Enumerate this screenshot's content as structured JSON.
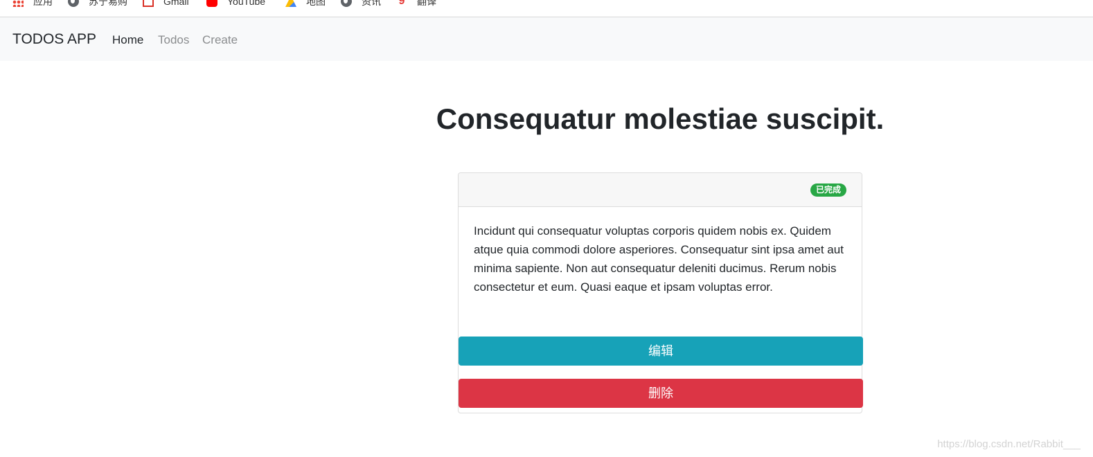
{
  "bookmarks": [
    {
      "label": "应用",
      "icon": "apps-grid-icon"
    },
    {
      "label": "苏宁易购",
      "icon": "globe-icon"
    },
    {
      "label": "Gmail",
      "icon": "gmail-icon"
    },
    {
      "label": "YouTube",
      "icon": "youtube-icon"
    },
    {
      "label": "地图",
      "icon": "maps-icon"
    },
    {
      "label": "资讯",
      "icon": "globe-icon"
    },
    {
      "label": "翻译",
      "icon": "translate-icon"
    }
  ],
  "navbar": {
    "brand": "TODOS APP",
    "links": [
      {
        "label": "Home",
        "active": true
      },
      {
        "label": "Todos",
        "active": false
      },
      {
        "label": "Create",
        "active": false
      }
    ]
  },
  "todo": {
    "title": "Consequatur molestiae suscipit.",
    "status_badge": "已完成",
    "description": "Incidunt qui consequatur voluptas corporis quidem nobis ex. Quidem atque quia commodi dolore asperiores. Consequatur sint ipsa amet aut minima sapiente. Non aut consequatur deleniti ducimus. Rerum nobis consectetur et eum. Quasi eaque et ipsam voluptas error.",
    "edit_label": "编辑",
    "delete_label": "删除"
  },
  "watermark": "https://blog.csdn.net/Rabbit___",
  "colors": {
    "navbar_bg": "#f8f9fa",
    "badge_success": "#28a745",
    "edit_button": "#17a2b8",
    "delete_button": "#dc3545"
  }
}
